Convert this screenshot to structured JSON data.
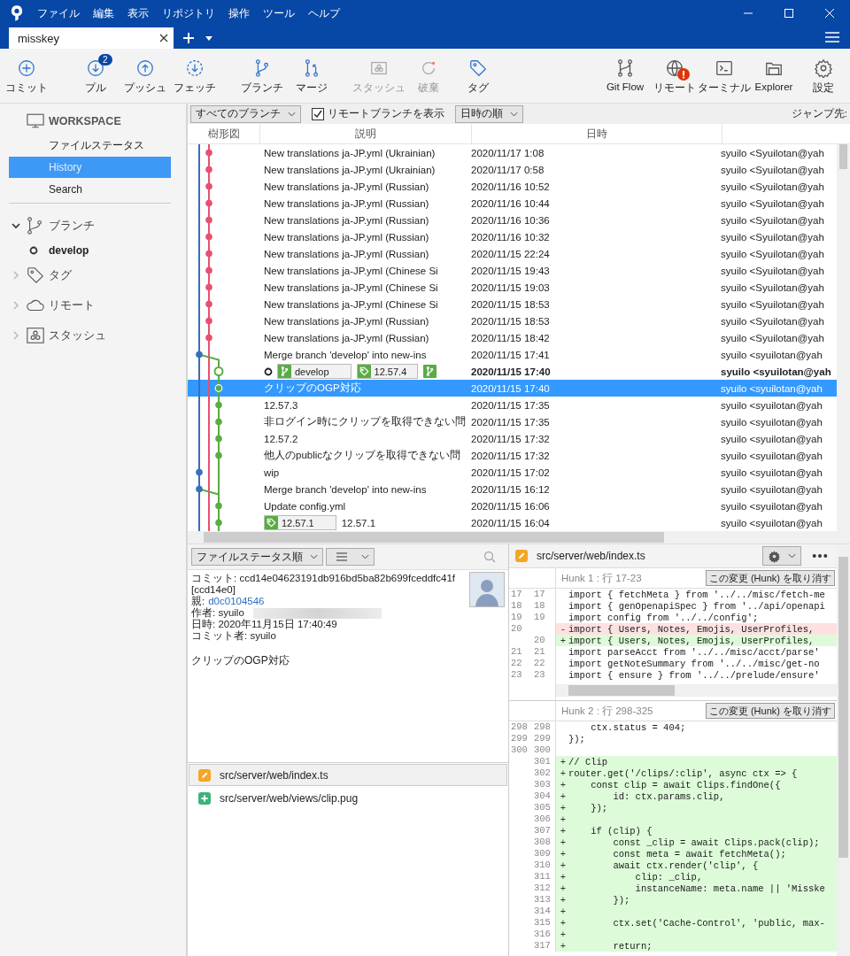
{
  "menu": [
    "ファイル",
    "編集",
    "表示",
    "リポジトリ",
    "操作",
    "ツール",
    "ヘルプ"
  ],
  "tab": {
    "label": "misskey",
    "selected": true
  },
  "toolbar": {
    "groups": [
      [
        {
          "label": "コミット",
          "disabled": false
        },
        {
          "label": "プル",
          "disabled": false,
          "badge": "2"
        },
        {
          "label": "プッシュ",
          "disabled": false
        },
        {
          "label": "フェッチ",
          "disabled": false
        }
      ],
      [
        {
          "label": "ブランチ",
          "disabled": false
        },
        {
          "label": "マージ",
          "disabled": false
        }
      ],
      [
        {
          "label": "スタッシュ",
          "disabled": true
        },
        {
          "label": "破棄",
          "disabled": true
        },
        {
          "label": "タグ",
          "disabled": false
        }
      ]
    ],
    "right": [
      {
        "label": "Git Flow",
        "alert": false
      },
      {
        "label": "リモート",
        "alert": true
      },
      {
        "label": "ターミナル",
        "alert": false
      },
      {
        "label": "Explorer",
        "alert": false
      },
      {
        "label": "設定",
        "alert": false
      }
    ]
  },
  "sidebar": {
    "workspace": {
      "title": "WORKSPACE",
      "items": [
        {
          "label": "ファイルステータス",
          "selected": false
        },
        {
          "label": "History",
          "selected": true
        },
        {
          "label": "Search",
          "selected": false
        }
      ]
    },
    "sections": [
      {
        "label": "ブランチ",
        "expanded": true,
        "children": [
          {
            "label": "develop",
            "current": true
          }
        ]
      },
      {
        "label": "タグ",
        "expanded": false
      },
      {
        "label": "リモート",
        "expanded": false
      },
      {
        "label": "スタッシュ",
        "expanded": false
      }
    ]
  },
  "history": {
    "branch_filter": "すべてのブランチ",
    "show_remote": {
      "label": "リモートブランチを表示",
      "checked": true
    },
    "sort": "日時の順",
    "jump_label": "ジャンプ先:",
    "columns": [
      "樹形図",
      "説明",
      "日時"
    ],
    "rows": [
      {
        "description": "New translations ja-JP.yml (Ukrainian)",
        "date": "2020/11/17 1:08",
        "author": "syuilo <Syuilotan@yah",
        "color": "#e8506e",
        "head": false,
        "merge": false,
        "selected": false
      },
      {
        "description": "New translations ja-JP.yml (Ukrainian)",
        "date": "2020/11/17 0:58",
        "author": "syuilo <Syuilotan@yah",
        "color": "#e8506e",
        "head": false,
        "merge": false,
        "selected": false
      },
      {
        "description": "New translations ja-JP.yml (Russian)",
        "date": "2020/11/16 10:52",
        "author": "syuilo <Syuilotan@yah",
        "color": "#e8506e",
        "head": false,
        "merge": false,
        "selected": false
      },
      {
        "description": "New translations ja-JP.yml (Russian)",
        "date": "2020/11/16 10:44",
        "author": "syuilo <Syuilotan@yah",
        "color": "#e8506e",
        "head": false,
        "merge": false,
        "selected": false
      },
      {
        "description": "New translations ja-JP.yml (Russian)",
        "date": "2020/11/16 10:36",
        "author": "syuilo <Syuilotan@yah",
        "color": "#e8506e",
        "head": false,
        "merge": false,
        "selected": false
      },
      {
        "description": "New translations ja-JP.yml (Russian)",
        "date": "2020/11/16 10:32",
        "author": "syuilo <Syuilotan@yah",
        "color": "#e8506e",
        "head": false,
        "merge": false,
        "selected": false
      },
      {
        "description": "New translations ja-JP.yml (Russian)",
        "date": "2020/11/15 22:24",
        "author": "syuilo <Syuilotan@yah",
        "color": "#e8506e",
        "head": false,
        "merge": false,
        "selected": false
      },
      {
        "description": "New translations ja-JP.yml (Chinese Si",
        "date": "2020/11/15 19:43",
        "author": "syuilo <Syuilotan@yah",
        "color": "#e8506e",
        "head": false,
        "merge": false,
        "selected": false
      },
      {
        "description": "New translations ja-JP.yml (Chinese Si",
        "date": "2020/11/15 19:03",
        "author": "syuilo <Syuilotan@yah",
        "color": "#e8506e",
        "head": false,
        "merge": false,
        "selected": false
      },
      {
        "description": "New translations ja-JP.yml (Chinese Si",
        "date": "2020/11/15 18:53",
        "author": "syuilo <Syuilotan@yah",
        "color": "#e8506e",
        "head": false,
        "merge": false,
        "selected": false
      },
      {
        "description": "New translations ja-JP.yml (Russian)",
        "date": "2020/11/15 18:53",
        "author": "syuilo <Syuilotan@yah",
        "color": "#e8506e",
        "head": false,
        "merge": false,
        "selected": false
      },
      {
        "description": "New translations ja-JP.yml (Russian)",
        "date": "2020/11/15 18:42",
        "author": "syuilo <Syuilotan@yah",
        "color": "#e8506e",
        "head": false,
        "merge": false,
        "selected": false
      },
      {
        "description": "Merge branch 'develop' into new-ins",
        "date": "2020/11/15 17:41",
        "author": "syuilo <syuilotan@yah",
        "color": "#3a6fb8",
        "head": false,
        "merge": true,
        "selected": false
      },
      {
        "refs": [
          {
            "kind": "branch",
            "label": "develop"
          },
          {
            "kind": "tag",
            "label": "12.57.4"
          },
          {
            "kind": "branch"
          }
        ],
        "date": "2020/11/15 17:40",
        "author": "syuilo <syuilotan@yah",
        "color": "#5aac44",
        "head": true,
        "merge": false,
        "selected": false
      },
      {
        "description": "クリップのOGP対応",
        "date": "2020/11/15 17:40",
        "author": "syuilo <syuilotan@yah",
        "color": "#5aac44",
        "head": false,
        "merge": false,
        "selected": true
      },
      {
        "description": "12.57.3",
        "date": "2020/11/15 17:35",
        "author": "syuilo <syuilotan@yah",
        "color": "#5aac44",
        "head": false,
        "merge": false,
        "selected": false
      },
      {
        "description": "非ログイン時にクリップを取得できない問",
        "date": "2020/11/15 17:35",
        "author": "syuilo <syuilotan@yah",
        "color": "#5aac44",
        "head": false,
        "merge": false,
        "selected": false
      },
      {
        "description": "12.57.2",
        "date": "2020/11/15 17:32",
        "author": "syuilo <syuilotan@yah",
        "color": "#5aac44",
        "head": false,
        "merge": false,
        "selected": false
      },
      {
        "description": "他人のpublicなクリップを取得できない問",
        "date": "2020/11/15 17:32",
        "author": "syuilo <syuilotan@yah",
        "color": "#5aac44",
        "head": false,
        "merge": false,
        "selected": false
      },
      {
        "description": "wip",
        "date": "2020/11/15 17:02",
        "author": "syuilo <syuilotan@yah",
        "color": "#3a6fb8",
        "head": false,
        "merge": false,
        "selected": false
      },
      {
        "description": "Merge branch 'develop' into new-ins",
        "date": "2020/11/15 16:12",
        "author": "syuilo <syuilotan@yah",
        "color": "#3a6fb8",
        "head": false,
        "merge": true,
        "selected": false
      },
      {
        "description": "Update config.yml",
        "date": "2020/11/15 16:06",
        "author": "syuilo <syuilotan@yah",
        "color": "#5aac44",
        "head": false,
        "merge": false,
        "selected": false
      },
      {
        "refs": [
          {
            "kind": "tag",
            "label": "12.57.1"
          }
        ],
        "description": "12.57.1",
        "date": "2020/11/15 16:04",
        "author": "syuilo <syuilotan@yah",
        "color": "#5aac44",
        "head": false,
        "merge": false,
        "selected": false
      }
    ]
  },
  "details": {
    "sort": "ファイルステータス順",
    "fields": [
      {
        "label": "コミット:",
        "value": "ccd14e04623191db916bd5ba82b699fceddfc41f [ccd14e0]",
        "kind": "text"
      },
      {
        "label": "親:",
        "value": "d0c0104546",
        "kind": "link"
      },
      {
        "label": "作者:",
        "value": "syuilo",
        "kind": "redacted"
      },
      {
        "label": "日時:",
        "value": "2020年11月15日 17:40:49",
        "kind": "text"
      },
      {
        "label": "コミット者:",
        "value": "syuilo",
        "kind": "text"
      }
    ],
    "message": "クリップのOGP対応",
    "files": [
      {
        "path": "src/server/web/index.ts",
        "kind": "modified",
        "selected": true
      },
      {
        "path": "src/server/web/views/clip.pug",
        "kind": "added",
        "selected": false
      }
    ]
  },
  "diff": {
    "file": {
      "path": "src/server/web/index.ts",
      "kind": "modified"
    },
    "hunks": [
      {
        "title": "Hunk 1 : 行 17-23",
        "button": "この変更 (Hunk) を取り消す",
        "lines": [
          {
            "old": "17",
            "new": "17",
            "kind": "context",
            "text": "import { fetchMeta } from '../../misc/fetch-me"
          },
          {
            "old": "18",
            "new": "18",
            "kind": "context",
            "text": "import { genOpenapiSpec } from '../api/openapi"
          },
          {
            "old": "19",
            "new": "19",
            "kind": "context",
            "text": "import config from '../../config';"
          },
          {
            "old": "20",
            "kind": "removed",
            "marker": "-",
            "text": "import { Users, Notes, Emojis, UserProfiles,"
          },
          {
            "new": "20",
            "kind": "added",
            "marker": "+",
            "text": "import { Users, Notes, Emojis, UserProfiles,"
          },
          {
            "old": "21",
            "new": "21",
            "kind": "context",
            "text": "import parseAcct from '../../misc/acct/parse'"
          },
          {
            "old": "22",
            "new": "22",
            "kind": "context",
            "text": "import getNoteSummary from '../../misc/get-no"
          },
          {
            "old": "23",
            "new": "23",
            "kind": "context",
            "text": "import { ensure } from '../../prelude/ensure'"
          }
        ]
      },
      {
        "title": "Hunk 2 : 行 298-325",
        "button": "この変更 (Hunk) を取り消す",
        "lines": [
          {
            "old": "298",
            "new": "298",
            "kind": "context",
            "text": "    ctx.status = 404;"
          },
          {
            "old": "299",
            "new": "299",
            "kind": "context",
            "text": "});"
          },
          {
            "old": "300",
            "new": "300",
            "kind": "context"
          },
          {
            "new": "301",
            "kind": "added",
            "marker": "+",
            "text": "// Clip"
          },
          {
            "new": "302",
            "kind": "added",
            "marker": "+",
            "text": "router.get('/clips/:clip', async ctx => {"
          },
          {
            "new": "303",
            "kind": "added",
            "marker": "+",
            "text": "    const clip = await Clips.findOne({"
          },
          {
            "new": "304",
            "kind": "added",
            "marker": "+",
            "text": "        id: ctx.params.clip,"
          },
          {
            "new": "305",
            "kind": "added",
            "marker": "+",
            "text": "    });"
          },
          {
            "new": "306",
            "kind": "added",
            "marker": "+"
          },
          {
            "new": "307",
            "kind": "added",
            "marker": "+",
            "text": "    if (clip) {"
          },
          {
            "new": "308",
            "kind": "added",
            "marker": "+",
            "text": "        const _clip = await Clips.pack(clip);"
          },
          {
            "new": "309",
            "kind": "added",
            "marker": "+",
            "text": "        const meta = await fetchMeta();"
          },
          {
            "new": "310",
            "kind": "added",
            "marker": "+",
            "text": "        await ctx.render('clip', {"
          },
          {
            "new": "311",
            "kind": "added",
            "marker": "+",
            "text": "            clip: _clip,"
          },
          {
            "new": "312",
            "kind": "added",
            "marker": "+",
            "text": "            instanceName: meta.name || 'Misske"
          },
          {
            "new": "313",
            "kind": "added",
            "marker": "+",
            "text": "        });"
          },
          {
            "new": "314",
            "kind": "added",
            "marker": "+"
          },
          {
            "new": "315",
            "kind": "added",
            "marker": "+",
            "text": "        ctx.set('Cache-Control', 'public, max-"
          },
          {
            "new": "316",
            "kind": "added",
            "marker": "+"
          },
          {
            "new": "317",
            "kind": "added",
            "marker": "+",
            "text": "        return;"
          }
        ]
      }
    ]
  }
}
